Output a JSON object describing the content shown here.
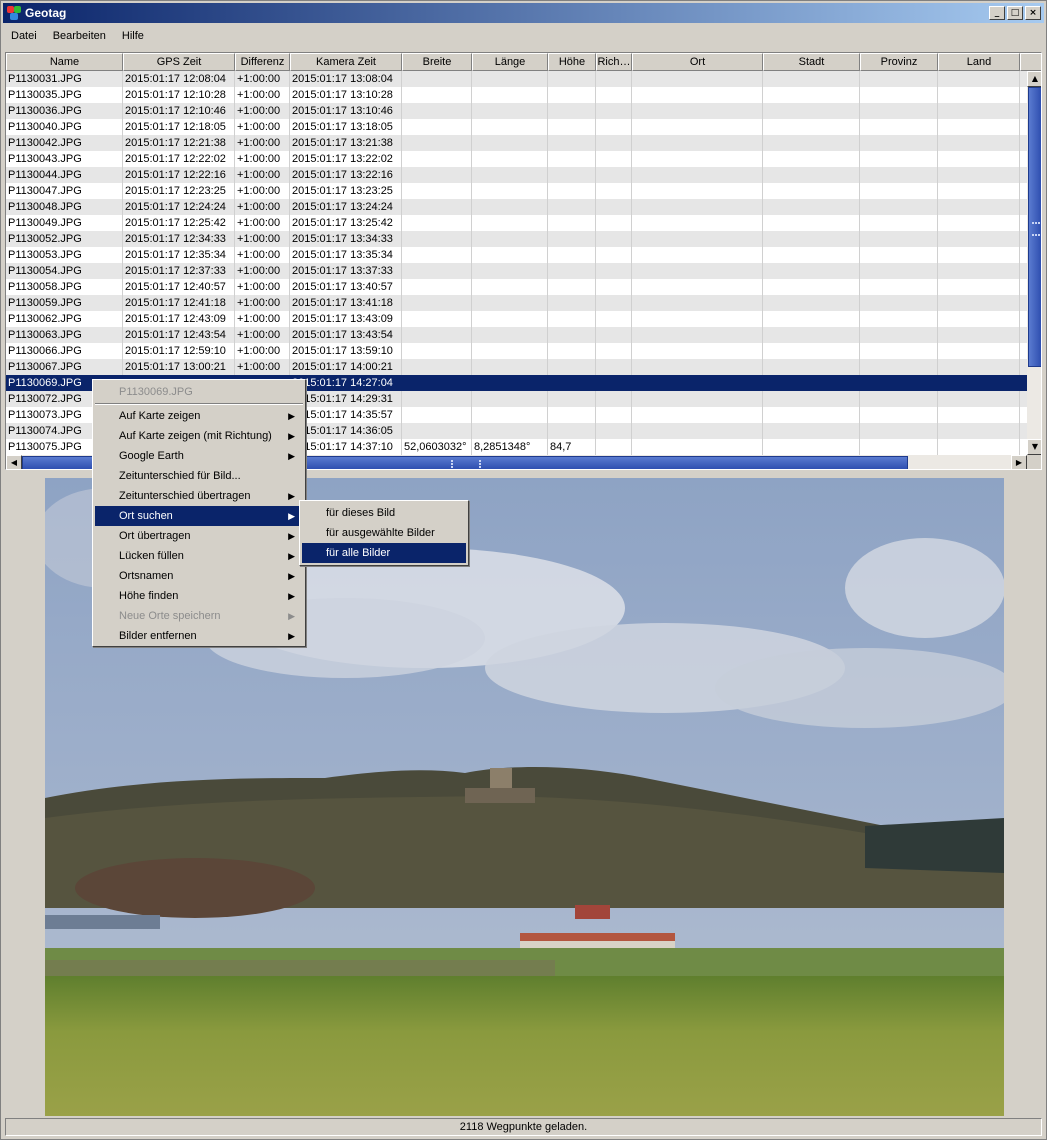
{
  "window": {
    "title": "Geotag",
    "minimize": "_",
    "maximize": "□",
    "close": "×"
  },
  "menubar": {
    "items": [
      "Datei",
      "Bearbeiten",
      "Hilfe"
    ]
  },
  "table": {
    "columns": [
      "Name",
      "GPS Zeit",
      "Differenz",
      "Kamera Zeit",
      "Breite",
      "Länge",
      "Höhe",
      "Rich…",
      "Ort",
      "Stadt",
      "Provinz",
      "Land"
    ],
    "rows": [
      [
        "P1130031.JPG",
        "2015:01:17 12:08:04",
        "+1:00:00",
        "2015:01:17 13:08:04",
        "",
        "",
        ""
      ],
      [
        "P1130035.JPG",
        "2015:01:17 12:10:28",
        "+1:00:00",
        "2015:01:17 13:10:28",
        "",
        "",
        ""
      ],
      [
        "P1130036.JPG",
        "2015:01:17 12:10:46",
        "+1:00:00",
        "2015:01:17 13:10:46",
        "",
        "",
        ""
      ],
      [
        "P1130040.JPG",
        "2015:01:17 12:18:05",
        "+1:00:00",
        "2015:01:17 13:18:05",
        "",
        "",
        ""
      ],
      [
        "P1130042.JPG",
        "2015:01:17 12:21:38",
        "+1:00:00",
        "2015:01:17 13:21:38",
        "",
        "",
        ""
      ],
      [
        "P1130043.JPG",
        "2015:01:17 12:22:02",
        "+1:00:00",
        "2015:01:17 13:22:02",
        "",
        "",
        ""
      ],
      [
        "P1130044.JPG",
        "2015:01:17 12:22:16",
        "+1:00:00",
        "2015:01:17 13:22:16",
        "",
        "",
        ""
      ],
      [
        "P1130047.JPG",
        "2015:01:17 12:23:25",
        "+1:00:00",
        "2015:01:17 13:23:25",
        "",
        "",
        ""
      ],
      [
        "P1130048.JPG",
        "2015:01:17 12:24:24",
        "+1:00:00",
        "2015:01:17 13:24:24",
        "",
        "",
        ""
      ],
      [
        "P1130049.JPG",
        "2015:01:17 12:25:42",
        "+1:00:00",
        "2015:01:17 13:25:42",
        "",
        "",
        ""
      ],
      [
        "P1130052.JPG",
        "2015:01:17 12:34:33",
        "+1:00:00",
        "2015:01:17 13:34:33",
        "",
        "",
        ""
      ],
      [
        "P1130053.JPG",
        "2015:01:17 12:35:34",
        "+1:00:00",
        "2015:01:17 13:35:34",
        "",
        "",
        ""
      ],
      [
        "P1130054.JPG",
        "2015:01:17 12:37:33",
        "+1:00:00",
        "2015:01:17 13:37:33",
        "",
        "",
        ""
      ],
      [
        "P1130058.JPG",
        "2015:01:17 12:40:57",
        "+1:00:00",
        "2015:01:17 13:40:57",
        "",
        "",
        ""
      ],
      [
        "P1130059.JPG",
        "2015:01:17 12:41:18",
        "+1:00:00",
        "2015:01:17 13:41:18",
        "",
        "",
        ""
      ],
      [
        "P1130062.JPG",
        "2015:01:17 12:43:09",
        "+1:00:00",
        "2015:01:17 13:43:09",
        "",
        "",
        ""
      ],
      [
        "P1130063.JPG",
        "2015:01:17 12:43:54",
        "+1:00:00",
        "2015:01:17 13:43:54",
        "",
        "",
        ""
      ],
      [
        "P1130066.JPG",
        "2015:01:17 12:59:10",
        "+1:00:00",
        "2015:01:17 13:59:10",
        "",
        "",
        ""
      ],
      [
        "P1130067.JPG",
        "2015:01:17 13:00:21",
        "+1:00:00",
        "2015:01:17 14:00:21",
        "",
        "",
        ""
      ],
      [
        "P1130069.JPG",
        "",
        "",
        "2015:01:17 14:27:04",
        "",
        "",
        ""
      ],
      [
        "P1130072.JPG",
        "",
        "",
        "2015:01:17 14:29:31",
        "",
        "",
        ""
      ],
      [
        "P1130073.JPG",
        "",
        "",
        "2015:01:17 14:35:57",
        "",
        "",
        ""
      ],
      [
        "P1130074.JPG",
        "",
        "",
        "2015:01:17 14:36:05",
        "",
        "",
        ""
      ],
      [
        "P1130075.JPG",
        "",
        "",
        "2015:01:17 14:37:10",
        "52,0603032°",
        "8,2851348°",
        "84,7"
      ]
    ],
    "selected_row": 19
  },
  "context_menu": {
    "header": "P1130069.JPG",
    "items": [
      {
        "label": "Auf Karte zeigen",
        "submenu": true,
        "disabled": false
      },
      {
        "label": "Auf Karte zeigen (mit Richtung)",
        "submenu": true,
        "disabled": false
      },
      {
        "label": "Google Earth",
        "submenu": true,
        "disabled": false
      },
      {
        "label": "Zeitunterschied für Bild...",
        "submenu": false,
        "disabled": false
      },
      {
        "label": "Zeitunterschied übertragen",
        "submenu": true,
        "disabled": false
      },
      {
        "label": "Ort suchen",
        "submenu": true,
        "disabled": false,
        "highlighted": true
      },
      {
        "label": "Ort übertragen",
        "submenu": true,
        "disabled": false
      },
      {
        "label": "Lücken füllen",
        "submenu": true,
        "disabled": false
      },
      {
        "label": "Ortsnamen",
        "submenu": true,
        "disabled": false
      },
      {
        "label": "Höhe finden",
        "submenu": true,
        "disabled": false
      },
      {
        "label": "Neue Orte speichern",
        "submenu": true,
        "disabled": true
      },
      {
        "label": "Bilder entfernen",
        "submenu": true,
        "disabled": false
      }
    ],
    "arrow": "▶"
  },
  "submenu": {
    "items": [
      "für dieses Bild",
      "für ausgewählte Bilder",
      "für alle Bilder"
    ],
    "highlighted": 2
  },
  "status": {
    "text": "2118 Wegpunkte geladen."
  },
  "colors": {
    "selection": "#0a246a",
    "face": "#d4d0c8"
  }
}
